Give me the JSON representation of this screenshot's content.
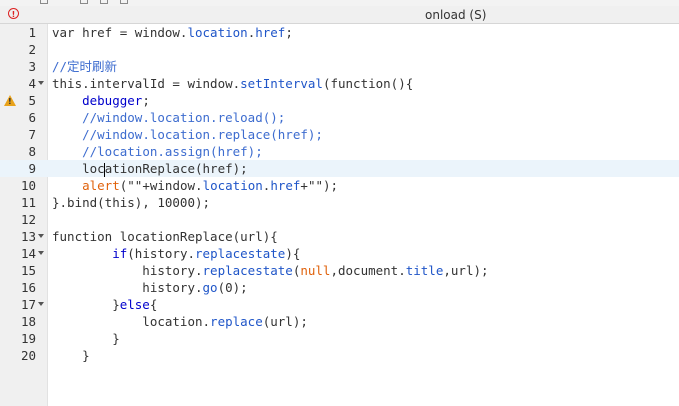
{
  "window": {
    "title": "onload (S)"
  },
  "lines": [
    {
      "n": "1",
      "code": "var href = window.location.href;"
    },
    {
      "n": "2",
      "code": ""
    },
    {
      "n": "3",
      "code": "//定时刷新"
    },
    {
      "n": "4",
      "code": "this.intervalId = window.setInterval(function(){",
      "fold": true
    },
    {
      "n": "5",
      "code": "    debugger;",
      "warning": true
    },
    {
      "n": "6",
      "code": "    //window.location.reload();"
    },
    {
      "n": "7",
      "code": "    //window.location.replace(href);"
    },
    {
      "n": "8",
      "code": "    //location.assign(href);"
    },
    {
      "n": "9",
      "code": "    locationReplace(href);",
      "active": true,
      "caret_after": "    loc"
    },
    {
      "n": "10",
      "code": "    alert(\"\"+window.location.href+\"\");"
    },
    {
      "n": "11",
      "code": "}.bind(this), 10000);"
    },
    {
      "n": "12",
      "code": ""
    },
    {
      "n": "13",
      "code": "function locationReplace(url){",
      "fold": true
    },
    {
      "n": "14",
      "code": "        if(history.replacestate){",
      "fold": true
    },
    {
      "n": "15",
      "code": "            history.replacestate(null,document.title,url);"
    },
    {
      "n": "16",
      "code": "            history.go(0);"
    },
    {
      "n": "17",
      "code": "        }else{",
      "fold": true
    },
    {
      "n": "18",
      "code": "            location.replace(url);"
    },
    {
      "n": "19",
      "code": "        }"
    },
    {
      "n": "20",
      "code": "    }"
    }
  ],
  "icons": {
    "error": "error-circle-icon",
    "warning": "warning-triangle-icon",
    "fold": "fold-arrow-icon"
  }
}
